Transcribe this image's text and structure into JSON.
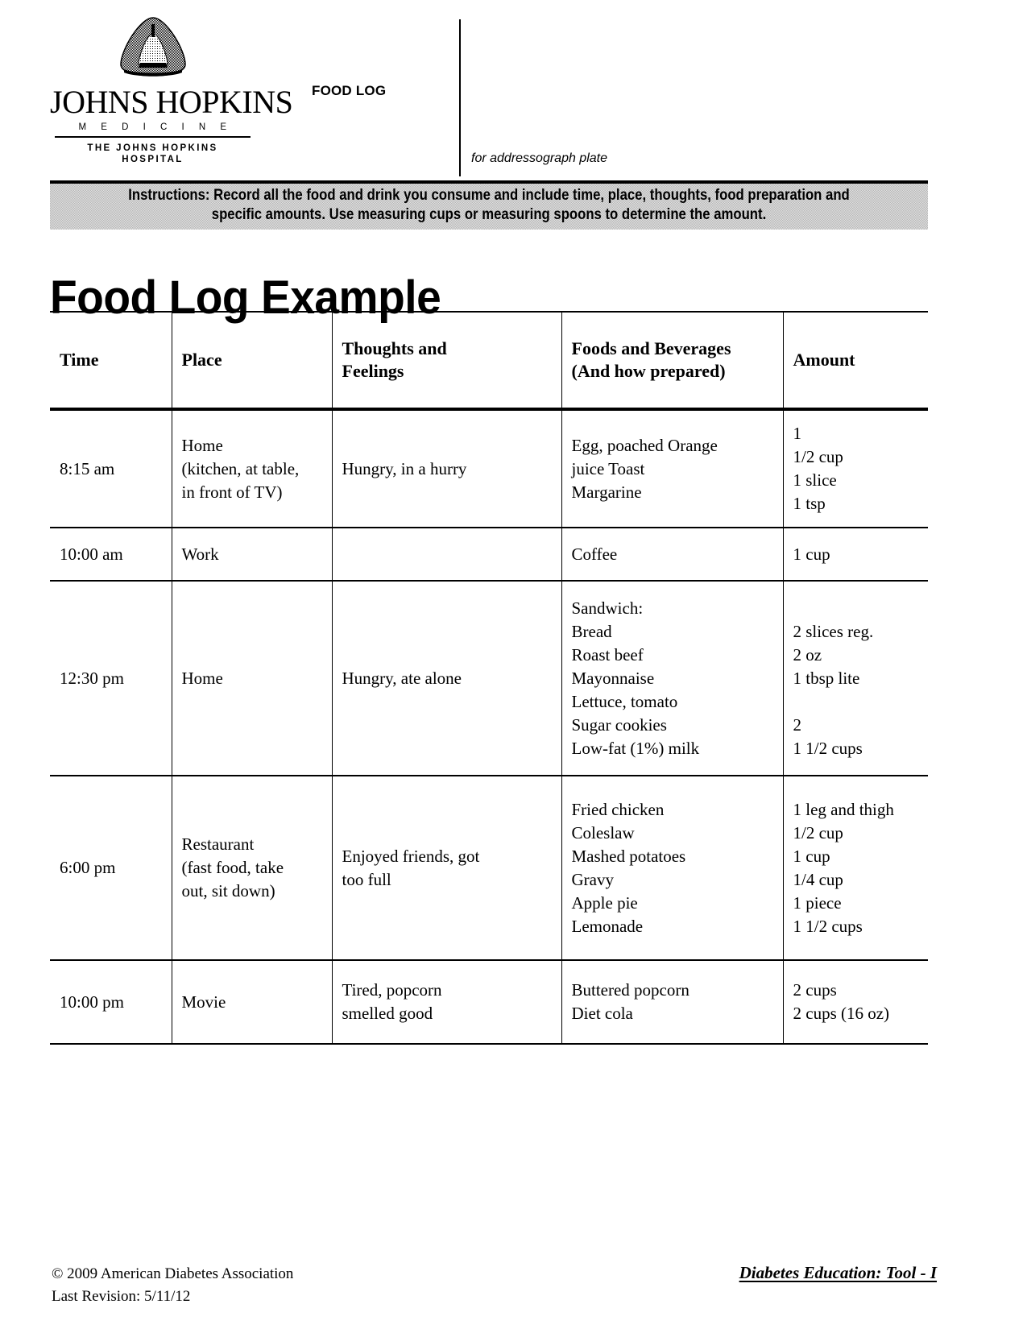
{
  "header": {
    "logo": {
      "icon": "johns-hopkins-dome-logo",
      "wordmark": "JOHNS HOPKINS",
      "division": "M E D I C I N E",
      "hospital_line1": "THE JOHNS HOPKINS",
      "hospital_line2": "HOSPITAL"
    },
    "form_title": "FOOD LOG",
    "addressograph_label": "for addressograph plate"
  },
  "instructions": {
    "lead": "Instructions:",
    "body": " Record all the food and drink you consume and include time, place, thoughts, food preparation and specific amounts.  Use measuring cups or measuring spoons to determine the amount."
  },
  "page_title": "Food Log Example",
  "table": {
    "columns": [
      "Time",
      "Place",
      "Thoughts and\nFeelings",
      "Foods and Beverages\n(And how prepared)",
      "Amount"
    ],
    "rows": [
      {
        "time": "8:15 am",
        "place": "Home\n(kitchen, at table,\nin front of TV)",
        "thoughts": "Hungry, in a hurry",
        "foods": "Egg, poached Orange\njuice Toast\nMargarine",
        "amount": "1\n1/2 cup\n1 slice\n1 tsp"
      },
      {
        "time": "10:00 am",
        "place": "Work",
        "thoughts": "",
        "foods": "Coffee",
        "amount": "1 cup"
      },
      {
        "time": "12:30 pm",
        "place": "Home",
        "thoughts": "Hungry, ate alone",
        "foods": "Sandwich:\nBread\nRoast beef\nMayonnaise\nLettuce, tomato\nSugar cookies\nLow-fat (1%) milk",
        "amount": "\n2 slices reg.\n2 oz\n1 tbsp lite\n\n2\n1 1/2 cups"
      },
      {
        "time": "6:00 pm",
        "place": "Restaurant\n(fast food, take\nout, sit down)",
        "thoughts": "Enjoyed friends, got\ntoo full",
        "foods": "Fried chicken\nColeslaw\nMashed potatoes\nGravy\nApple pie\nLemonade",
        "amount": "1 leg and thigh\n1/2 cup\n1 cup\n1/4 cup\n1 piece\n1 1/2 cups"
      },
      {
        "time": "10:00 pm",
        "place": "Movie",
        "thoughts": "Tired, popcorn\nsmelled good",
        "foods": "Buttered popcorn\nDiet cola",
        "amount": "2 cups\n2 cups (16 oz)"
      }
    ]
  },
  "footer": {
    "copyright": "© 2009 American Diabetes Association",
    "revision": "Last Revision: 5/11/12",
    "tool_label": "Diabetes Education: Tool - I"
  }
}
